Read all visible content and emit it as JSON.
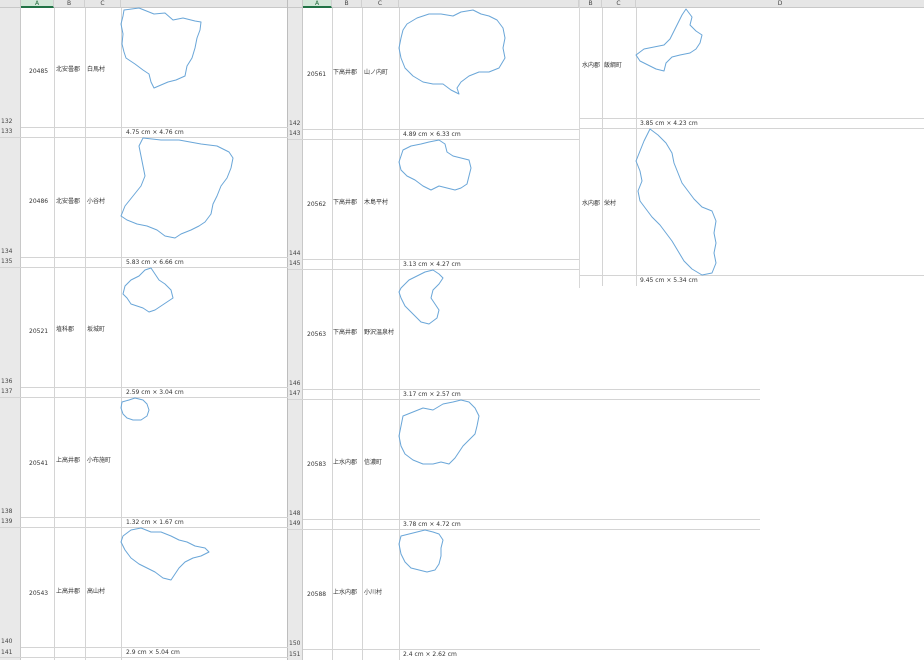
{
  "panes": [
    {
      "columns": [
        "A",
        "B",
        "C"
      ],
      "rows": [
        {
          "row_num": "132",
          "sep_num": "133",
          "code": "20485",
          "district": "北安曇郡",
          "town": "白馬村",
          "dims": "4.75 cm × 4.76 cm"
        },
        {
          "row_num": "134",
          "sep_num": "135",
          "code": "20486",
          "district": "北安曇郡",
          "town": "小谷村",
          "dims": "5.83 cm × 6.66 cm"
        },
        {
          "row_num": "136",
          "sep_num": "137",
          "code": "20521",
          "district": "埴科郡",
          "town": "坂城町",
          "dims": "2.59 cm × 3.04 cm"
        },
        {
          "row_num": "138",
          "sep_num": "139",
          "code": "20541",
          "district": "上高井郡",
          "town": "小布施町",
          "dims": "1.32 cm × 1.67 cm"
        },
        {
          "row_num": "140",
          "sep_num": "141",
          "code": "20543",
          "district": "上高井郡",
          "town": "高山村",
          "dims": "2.9 cm × 5.04 cm"
        }
      ]
    },
    {
      "columns": [
        "A",
        "B",
        "C"
      ],
      "rows": [
        {
          "row_num": "142",
          "sep_num": "143",
          "code": "20561",
          "district": "下高井郡",
          "town": "山ノ内町",
          "dims": "4.89 cm × 6.33 cm"
        },
        {
          "row_num": "144",
          "sep_num": "145",
          "code": "20562",
          "district": "下高井郡",
          "town": "木島平村",
          "dims": "3.13 cm × 4.27 cm"
        },
        {
          "row_num": "146",
          "sep_num": "147",
          "code": "20563",
          "district": "下高井郡",
          "town": "野沢温泉村",
          "dims": "3.17 cm × 2.57 cm"
        },
        {
          "row_num": "148",
          "sep_num": "149",
          "code": "20583",
          "district": "上水内郡",
          "town": "信濃町",
          "dims": "3.78 cm × 4.72 cm"
        },
        {
          "row_num": "150",
          "sep_num": "151",
          "code": "20588",
          "district": "上水内郡",
          "town": "小川村",
          "dims": "2.4 cm × 2.62 cm"
        }
      ]
    },
    {
      "columns": [
        "B",
        "C",
        "D"
      ],
      "rows": [
        {
          "district": "水内郡",
          "town": "飯綱町",
          "dims": "3.85 cm × 4.23 cm"
        },
        {
          "district": "水内郡",
          "town": "栄村",
          "dims": "9.45 cm × 5.34 cm"
        }
      ]
    }
  ]
}
